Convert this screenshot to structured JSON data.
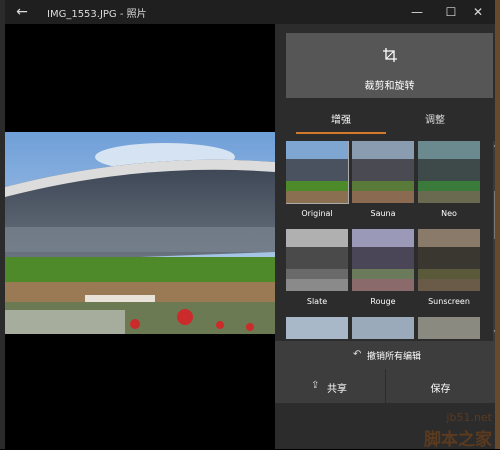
{
  "titlebar": {
    "back_icon": "arrow-left-icon",
    "title": "IMG_1553.JPG - 照片",
    "minimize_icon": "minimize-icon",
    "maximize_icon": "maximize-icon",
    "close_icon": "close-icon"
  },
  "editor": {
    "crop_icon": "crop-icon",
    "crop_label": "裁剪和旋转",
    "tabs": [
      {
        "label": "增强",
        "active": true
      },
      {
        "label": "调整",
        "active": false
      }
    ],
    "filters": [
      {
        "label": "Original"
      },
      {
        "label": "Sauna"
      },
      {
        "label": "Neo"
      },
      {
        "label": "Slate"
      },
      {
        "label": "Rouge"
      },
      {
        "label": "Sunscreen"
      },
      {
        "label": ""
      },
      {
        "label": ""
      },
      {
        "label": ""
      }
    ],
    "revert_icon": "undo-icon",
    "revert_label": "撤销所有编辑",
    "share_icon": "share-icon",
    "share_label": "共享",
    "save_label": "保存"
  },
  "watermark": {
    "url": "jb51.net",
    "name": "脚本之家"
  },
  "colors": {
    "accent": "#d07a2a",
    "panel": "#2c2c2c",
    "button": "#565656"
  }
}
